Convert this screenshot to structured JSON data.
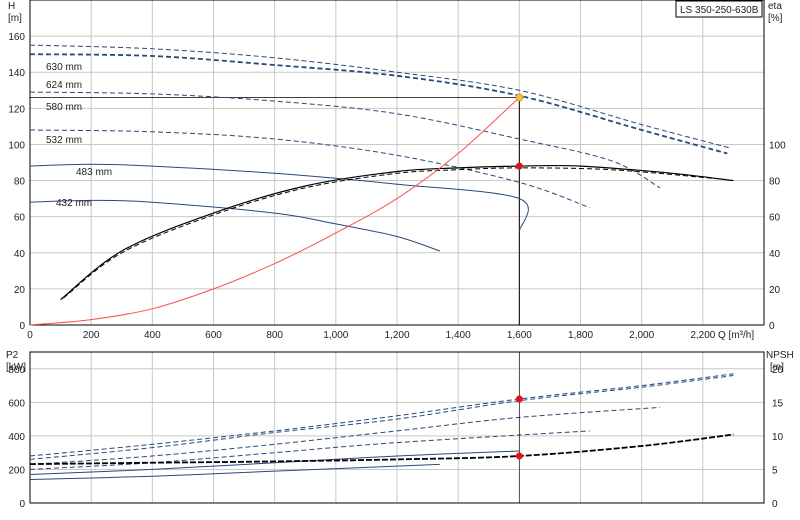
{
  "chart_data": [
    {
      "type": "line",
      "title": "LS 350-250-630B",
      "x_axis": {
        "label": "Q [m³/h]",
        "range": [
          0,
          2400
        ],
        "ticks": [
          0,
          200,
          400,
          600,
          800,
          1000,
          1200,
          1400,
          1600,
          1800,
          2000,
          2200
        ],
        "tick_labels": [
          "0",
          "200",
          "400",
          "600",
          "800",
          "1,000",
          "1,200",
          "1,400",
          "1,600",
          "1,800",
          "2,000",
          "2,200"
        ]
      },
      "y_axis_left": {
        "label_line1": "H",
        "label_line2": "[m]",
        "range": [
          0,
          180
        ],
        "ticks": [
          0,
          20,
          40,
          60,
          80,
          100,
          120,
          140,
          160
        ]
      },
      "y_axis_right": {
        "label_line1": "eta",
        "label_line2": "[%]",
        "range": [
          0,
          180
        ],
        "ticks": [
          0,
          20,
          40,
          60,
          80,
          100
        ]
      },
      "grid": true,
      "head_curves": [
        {
          "name": "630 mm",
          "color": "#27497a",
          "style": "dashed",
          "width": 1.8,
          "points": [
            [
              0,
              150
            ],
            [
              400,
              149
            ],
            [
              800,
              144
            ],
            [
              1200,
              138
            ],
            [
              1600,
              127
            ],
            [
              2000,
              108
            ],
            [
              2280,
              95
            ]
          ]
        },
        {
          "name": "624 mm",
          "color": "#27497a",
          "style": "dashed",
          "width": 1.0,
          "points": [
            [
              0,
              155
            ],
            [
              400,
              153
            ],
            [
              800,
              148
            ],
            [
              1200,
              140
            ],
            [
              1600,
              130
            ],
            [
              2000,
              111
            ],
            [
              2290,
              98
            ]
          ]
        },
        {
          "name": "580 mm",
          "color": "#27497a",
          "style": "dashed",
          "width": 1.0,
          "points": [
            [
              0,
              129
            ],
            [
              400,
              128
            ],
            [
              800,
              124
            ],
            [
              1200,
              117
            ],
            [
              1600,
              103
            ],
            [
              1900,
              91
            ],
            [
              2060,
              76
            ]
          ]
        },
        {
          "name": "532 mm",
          "color": "#27497a",
          "style": "dashed",
          "width": 1.0,
          "points": [
            [
              0,
              108
            ],
            [
              400,
              107
            ],
            [
              800,
              103
            ],
            [
              1200,
              94
            ],
            [
              1600,
              79
            ],
            [
              1830,
              65
            ]
          ]
        },
        {
          "name": "483 mm",
          "color": "#27497a",
          "style": "solid",
          "width": 1.0,
          "points": [
            [
              0,
              88
            ],
            [
              200,
              89
            ],
            [
              400,
              88
            ],
            [
              800,
              84
            ],
            [
              1200,
              78
            ],
            [
              1600,
              70
            ],
            [
              1600,
              52
            ]
          ]
        },
        {
          "name": "432 mm",
          "color": "#27497a",
          "style": "solid",
          "width": 1.0,
          "points": [
            [
              0,
              68
            ],
            [
              200,
              69
            ],
            [
              400,
              68
            ],
            [
              800,
              62
            ],
            [
              1000,
              56
            ],
            [
              1200,
              49
            ],
            [
              1340,
              41
            ]
          ]
        }
      ],
      "efficiency_curves": [
        {
          "name": "",
          "color": "#000000",
          "style": "solid",
          "points": [
            [
              100,
              14
            ],
            [
              300,
              41
            ],
            [
              600,
              62
            ],
            [
              900,
              77
            ],
            [
              1200,
              85
            ],
            [
              1400,
              87
            ],
            [
              1600,
              88
            ],
            [
              1800,
              88
            ],
            [
              2100,
              84
            ],
            [
              2300,
              80
            ]
          ]
        },
        {
          "name": "",
          "color": "#000000",
          "style": "dashed",
          "points": [
            [
              110,
              15
            ],
            [
              300,
              40
            ],
            [
              600,
              61
            ],
            [
              900,
              76
            ],
            [
              1200,
              84
            ],
            [
              1400,
              86
            ],
            [
              1600,
              87
            ],
            [
              1900,
              86
            ],
            [
              2250,
              81
            ]
          ]
        }
      ],
      "system_curve": {
        "color": "#ff4d4d",
        "points": [
          [
            0,
            0
          ],
          [
            200,
            3
          ],
          [
            400,
            9
          ],
          [
            600,
            20
          ],
          [
            800,
            34
          ],
          [
            1000,
            51
          ],
          [
            1200,
            70
          ],
          [
            1400,
            95
          ],
          [
            1600,
            126
          ]
        ]
      },
      "operating_point": {
        "q": 1600,
        "h": 126,
        "eta": 88
      }
    },
    {
      "type": "line",
      "x_axis": {
        "range": [
          0,
          2400
        ]
      },
      "y_axis_left": {
        "label_line1": "P2",
        "label_line2": "[kW]",
        "range": [
          0,
          900
        ],
        "ticks": [
          0,
          200,
          400,
          600,
          800
        ]
      },
      "y_axis_right": {
        "label_line1": "NPSH",
        "label_line2": "[m]",
        "range": [
          0,
          22.5
        ],
        "ticks": [
          0,
          5,
          10,
          15,
          20
        ]
      },
      "grid": true,
      "power_curves": [
        {
          "color": "#27497a",
          "style": "dashed",
          "points": [
            [
              0,
              260
            ],
            [
              400,
              330
            ],
            [
              800,
              420
            ],
            [
              1200,
              500
            ],
            [
              1600,
              610
            ],
            [
              2000,
              690
            ],
            [
              2300,
              760
            ]
          ]
        },
        {
          "color": "#27497a",
          "style": "dashed",
          "points": [
            [
              0,
              280
            ],
            [
              400,
              350
            ],
            [
              800,
              430
            ],
            [
              1200,
              520
            ],
            [
              1600,
              620
            ],
            [
              2000,
              700
            ],
            [
              2300,
              770
            ]
          ]
        },
        {
          "color": "#27497a",
          "style": "dashed",
          "points": [
            [
              0,
              230
            ],
            [
              400,
              280
            ],
            [
              800,
              350
            ],
            [
              1200,
              430
            ],
            [
              1600,
              510
            ],
            [
              2060,
              570
            ]
          ]
        },
        {
          "color": "#27497a",
          "style": "dashed",
          "points": [
            [
              0,
              200
            ],
            [
              400,
              240
            ],
            [
              800,
              300
            ],
            [
              1200,
              360
            ],
            [
              1830,
              430
            ]
          ]
        },
        {
          "color": "#27497a",
          "style": "solid",
          "points": [
            [
              0,
              170
            ],
            [
              400,
              200
            ],
            [
              800,
              240
            ],
            [
              1200,
              280
            ],
            [
              1600,
              310
            ]
          ]
        },
        {
          "color": "#27497a",
          "style": "solid",
          "points": [
            [
              0,
              140
            ],
            [
              400,
              160
            ],
            [
              800,
              190
            ],
            [
              1340,
              230
            ]
          ]
        }
      ],
      "npsh_curve": {
        "color": "#000000",
        "points": [
          [
            0,
            5.8
          ],
          [
            400,
            6.0
          ],
          [
            800,
            6.2
          ],
          [
            1200,
            6.5
          ],
          [
            1600,
            7.0
          ],
          [
            2000,
            8.5
          ],
          [
            2300,
            10.2
          ]
        ]
      },
      "operating_points": {
        "p2": 620,
        "npsh": 7.0
      }
    }
  ]
}
